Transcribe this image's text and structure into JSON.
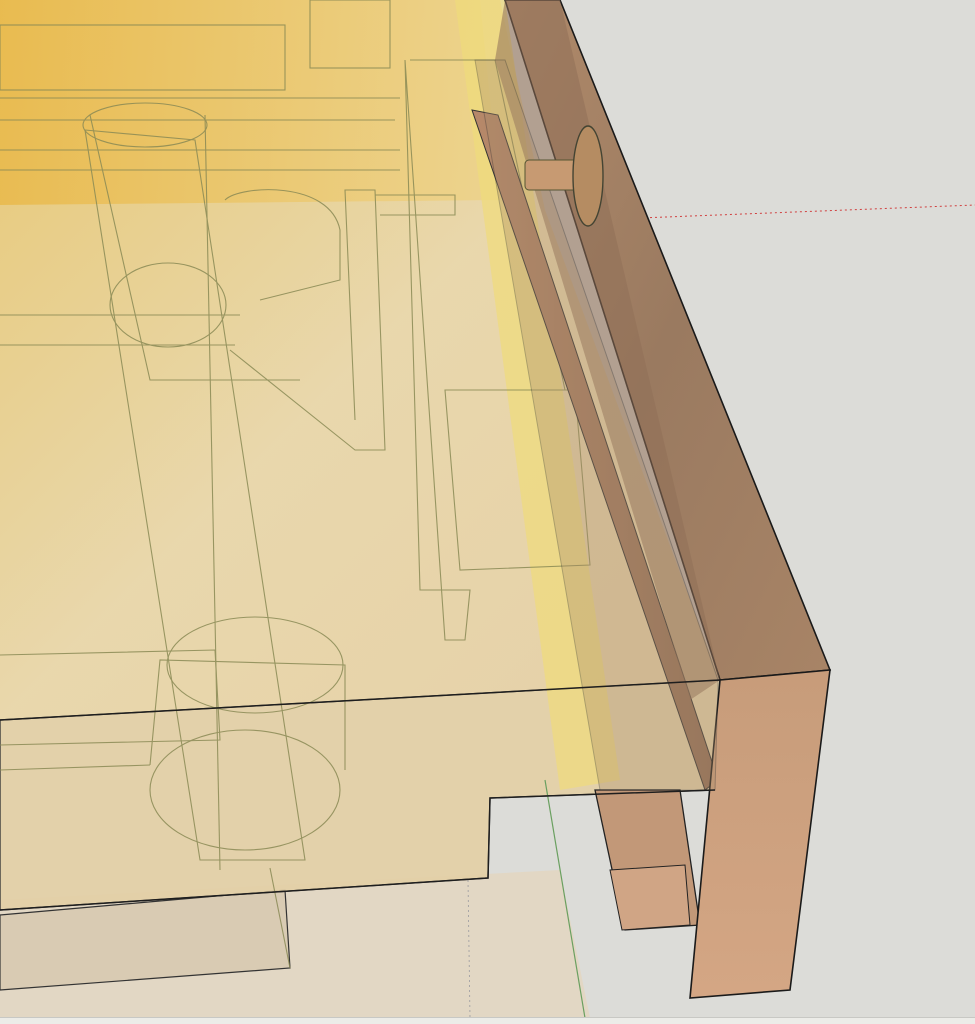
{
  "app": {
    "title": ""
  },
  "scene": {
    "background_color": "#dcdcd8",
    "wood_fill_color": "#9a7b60",
    "wood_light_color": "#c79a78",
    "transparent_face_color": "#e6c97a",
    "edge_color": "#222222",
    "ghost_edge_color": "#8a8a55",
    "ground_plane_color": "#e9dcc2",
    "axis_red_color": "#d04040"
  },
  "toolbar": {
    "orbit_icon": "orbit-icon"
  }
}
